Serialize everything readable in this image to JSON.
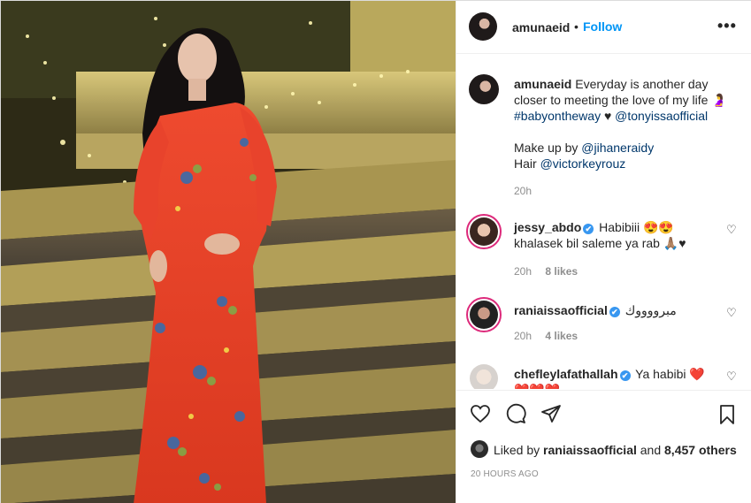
{
  "header": {
    "username": "amunaeid",
    "separator": "•",
    "follow_label": "Follow",
    "more_label": "•••"
  },
  "caption": {
    "username": "amunaeid",
    "text": "Everyday is another day closer to meeting the love of my life 🤰",
    "hashtag": "#babyontheway",
    "heart": "♥",
    "mention": "@tonyissaofficial",
    "makeup_prefix": "Make up by",
    "makeup_mention": "@jihaneraidy",
    "hair_prefix": "Hair",
    "hair_mention": "@victorkeyrouz",
    "time": "20h"
  },
  "comments": [
    {
      "username": "jessy_abdo",
      "text": "Habibiii 😍😍",
      "text2": "khalasek bil saleme ya rab 🙏🏽♥",
      "time": "20h",
      "likes": "8 likes"
    },
    {
      "username": "raniaissaofficial",
      "text": "مبرووووك",
      "time": "20h",
      "likes": "4 likes"
    },
    {
      "username": "chefleylafathallah",
      "text": "Ya habibi ❤️",
      "text2": "❤️❤️❤️"
    }
  ],
  "icons": {
    "verified": "✔",
    "comment_heart": "♡"
  },
  "likes": {
    "prefix": "Liked by",
    "user": "raniaissaofficial",
    "middle": "and",
    "count": "8,457 others"
  },
  "timestamp": "20 HOURS AGO",
  "colors": {
    "accent": "#0095f6",
    "link": "#00376b",
    "verified": "#3897f0",
    "dress": "#e8432c"
  }
}
